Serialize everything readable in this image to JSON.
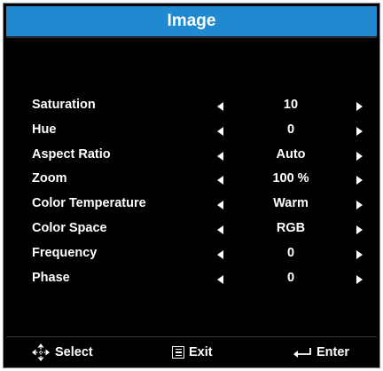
{
  "menu": {
    "title": "Image",
    "items": [
      {
        "label": "Saturation",
        "value": "10"
      },
      {
        "label": "Hue",
        "value": "0"
      },
      {
        "label": "Aspect Ratio",
        "value": "Auto"
      },
      {
        "label": "Zoom",
        "value": "100 %"
      },
      {
        "label": "Color Temperature",
        "value": "Warm"
      },
      {
        "label": "Color Space",
        "value": "RGB"
      },
      {
        "label": "Frequency",
        "value": "0"
      },
      {
        "label": "Phase",
        "value": "0"
      }
    ]
  },
  "footer": {
    "select_label": "Select",
    "exit_label": "Exit",
    "enter_label": "Enter"
  },
  "colors": {
    "title_bar": "#1f8ad0",
    "background": "#000000",
    "text": "#ffffff"
  },
  "icons": {
    "select": "four-way-arrows-icon",
    "exit": "menu-icon",
    "enter": "enter-return-icon",
    "decrease": "triangle-left-icon",
    "increase": "triangle-right-icon"
  }
}
